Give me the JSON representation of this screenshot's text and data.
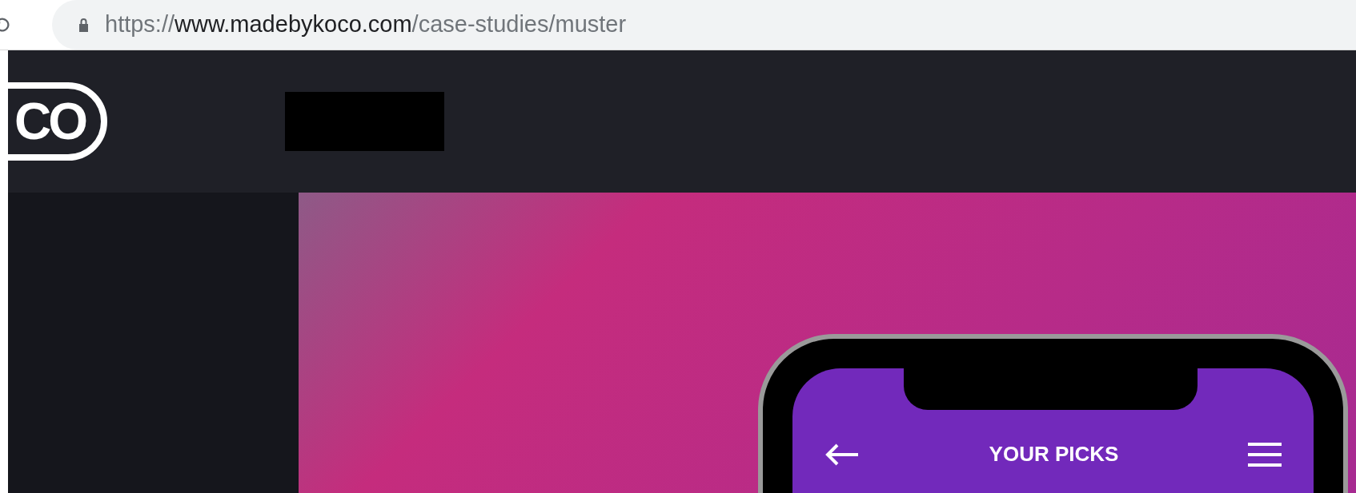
{
  "browser": {
    "url": {
      "scheme": "https://",
      "host": "www.madebykoco.com",
      "path": "/case-studies/muster"
    }
  },
  "header": {
    "logo": "CO"
  },
  "phone": {
    "screen_title": "YOUR PICKS"
  }
}
